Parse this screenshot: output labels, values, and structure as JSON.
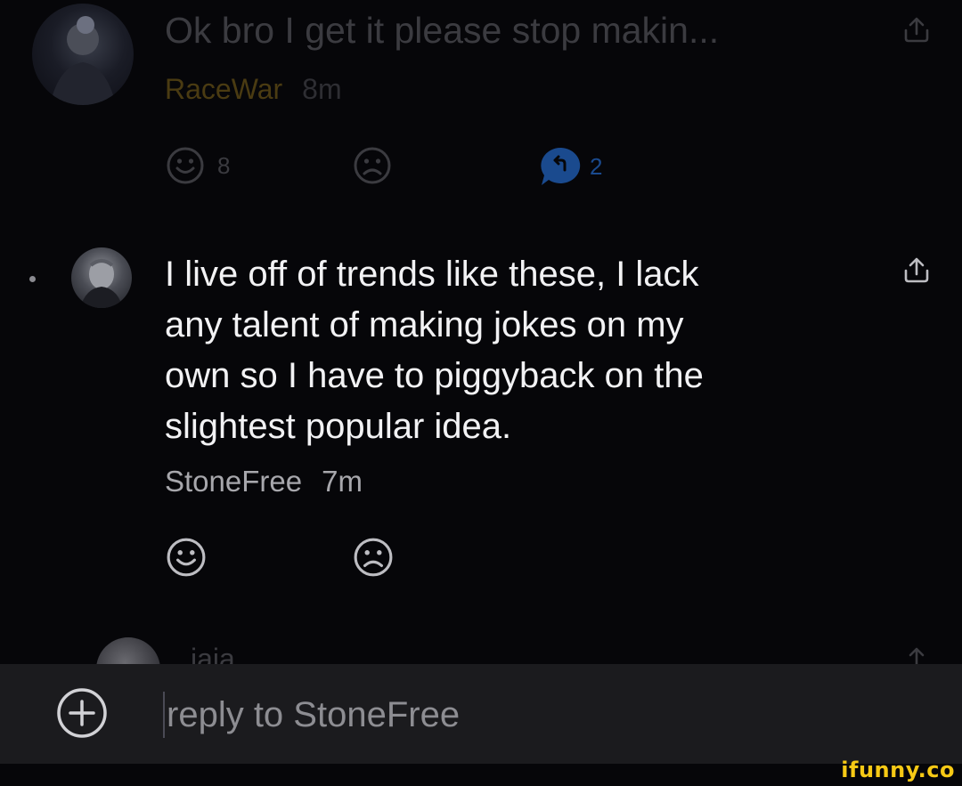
{
  "colors": {
    "background": "#060609",
    "dim_text": "#3b3b40",
    "username_dim": "#4a3b12",
    "reply_accent": "#1a4a8e",
    "body_text": "#f2f2f4",
    "meta_text": "#a7a7ac",
    "icon": "#bdbdc2",
    "reply_bar": "#1b1b1e",
    "watermark": "#f6c915"
  },
  "comments": [
    {
      "text": "Ok bro I get it please stop makin...",
      "username": "RaceWar",
      "time": "8m",
      "smile_count": "8",
      "replies_count": "2",
      "icons": [
        "avatar",
        "share-icon",
        "smile-icon",
        "frown-icon",
        "reply-bubble-icon"
      ]
    },
    {
      "text_lines": [
        "I live off of trends like these, I lack",
        "any talent of making jokes on my",
        "own so I have to piggyback on the",
        "slightest popular idea."
      ],
      "username": "StoneFree",
      "time": "7m",
      "icons": [
        "avatar",
        "share-icon",
        "smile-icon",
        "frown-icon"
      ]
    },
    {
      "username_partial": "iaia",
      "icons": [
        "avatar",
        "share-icon"
      ]
    }
  ],
  "reply_bar": {
    "placeholder": "reply to StoneFree",
    "icon": "plus-circle-icon"
  },
  "watermark": "ifunny.co"
}
